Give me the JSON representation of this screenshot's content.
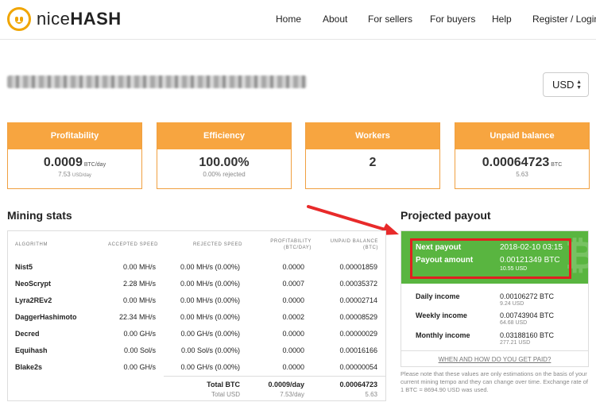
{
  "brand": {
    "name_light": "nice",
    "name_bold": "HASH"
  },
  "nav": {
    "home": "Home",
    "about": "About",
    "sellers": "For sellers",
    "buyers": "For buyers",
    "help": "Help",
    "register": "Register / Login"
  },
  "currency": {
    "selected": "USD"
  },
  "cards": {
    "profitability": {
      "label": "Profitability",
      "value": "0.0009",
      "unit": "BTC/day",
      "sub": "7.53",
      "sub_unit": "USD/day"
    },
    "efficiency": {
      "label": "Efficiency",
      "value": "100.00%",
      "sub": "0.00% rejected"
    },
    "workers": {
      "label": "Workers",
      "value": "2"
    },
    "unpaid": {
      "label": "Unpaid balance",
      "value": "0.00064723",
      "unit": "BTC",
      "sub": "5.63"
    }
  },
  "mining": {
    "title": "Mining stats",
    "headers": {
      "algorithm": "ALGORITHM",
      "accepted": "ACCEPTED SPEED",
      "rejected": "REJECTED SPEED",
      "profitability": "PROFITABILITY",
      "profitability_unit": "(BTC/DAY)",
      "unpaid": "UNPAID BALANCE",
      "unpaid_unit": "(BTC)"
    },
    "rows": [
      {
        "algo": "Nist5",
        "accepted": "0.00 MH/s",
        "rejected": "0.00 MH/s (0.00%)",
        "profit": "0.0000",
        "unpaid": "0.00001859"
      },
      {
        "algo": "NeoScrypt",
        "accepted": "2.28 MH/s",
        "rejected": "0.00 MH/s (0.00%)",
        "profit": "0.0007",
        "unpaid": "0.00035372"
      },
      {
        "algo": "Lyra2REv2",
        "accepted": "0.00 MH/s",
        "rejected": "0.00 MH/s (0.00%)",
        "profit": "0.0000",
        "unpaid": "0.00002714"
      },
      {
        "algo": "DaggerHashimoto",
        "accepted": "22.34 MH/s",
        "rejected": "0.00 MH/s (0.00%)",
        "profit": "0.0002",
        "unpaid": "0.00008529"
      },
      {
        "algo": "Decred",
        "accepted": "0.00 GH/s",
        "rejected": "0.00 GH/s (0.00%)",
        "profit": "0.0000",
        "unpaid": "0.00000029"
      },
      {
        "algo": "Equihash",
        "accepted": "0.00 Sol/s",
        "rejected": "0.00 Sol/s (0.00%)",
        "profit": "0.0000",
        "unpaid": "0.00016166"
      },
      {
        "algo": "Blake2s",
        "accepted": "0.00 GH/s",
        "rejected": "0.00 GH/s (0.00%)",
        "profit": "0.0000",
        "unpaid": "0.00000054"
      }
    ],
    "total_btc_label": "Total BTC",
    "total_btc_profit": "0.0009/day",
    "total_btc_unpaid": "0.00064723",
    "total_usd_label": "Total USD",
    "total_usd_profit": "7.53/day",
    "total_usd_unpaid": "5.63"
  },
  "payout": {
    "title": "Projected payout",
    "next_label": "Next payout",
    "next_value": "2018-02-10 03:15",
    "amount_label": "Payout amount",
    "amount_value": "0.00121349 BTC",
    "amount_usd": "10.55 USD",
    "daily_label": "Daily income",
    "daily_btc": "0.00106272 BTC",
    "daily_usd": "9.24 USD",
    "weekly_label": "Weekly income",
    "weekly_btc": "0.00743904 BTC",
    "weekly_usd": "64.68 USD",
    "monthly_label": "Monthly income",
    "monthly_btc": "0.03188160 BTC",
    "monthly_usd": "277.21 USD",
    "faq_link": "WHEN AND HOW DO YOU GET PAID?",
    "note": "Please note that these values are only estimations on the basis of your current mining tempo and they can change over time. Exchange rate of 1 BTC = 8694.90 USD was used."
  },
  "colors": {
    "orange": "#f7a540",
    "green": "#59b540",
    "highlight_red": "#e02020"
  }
}
